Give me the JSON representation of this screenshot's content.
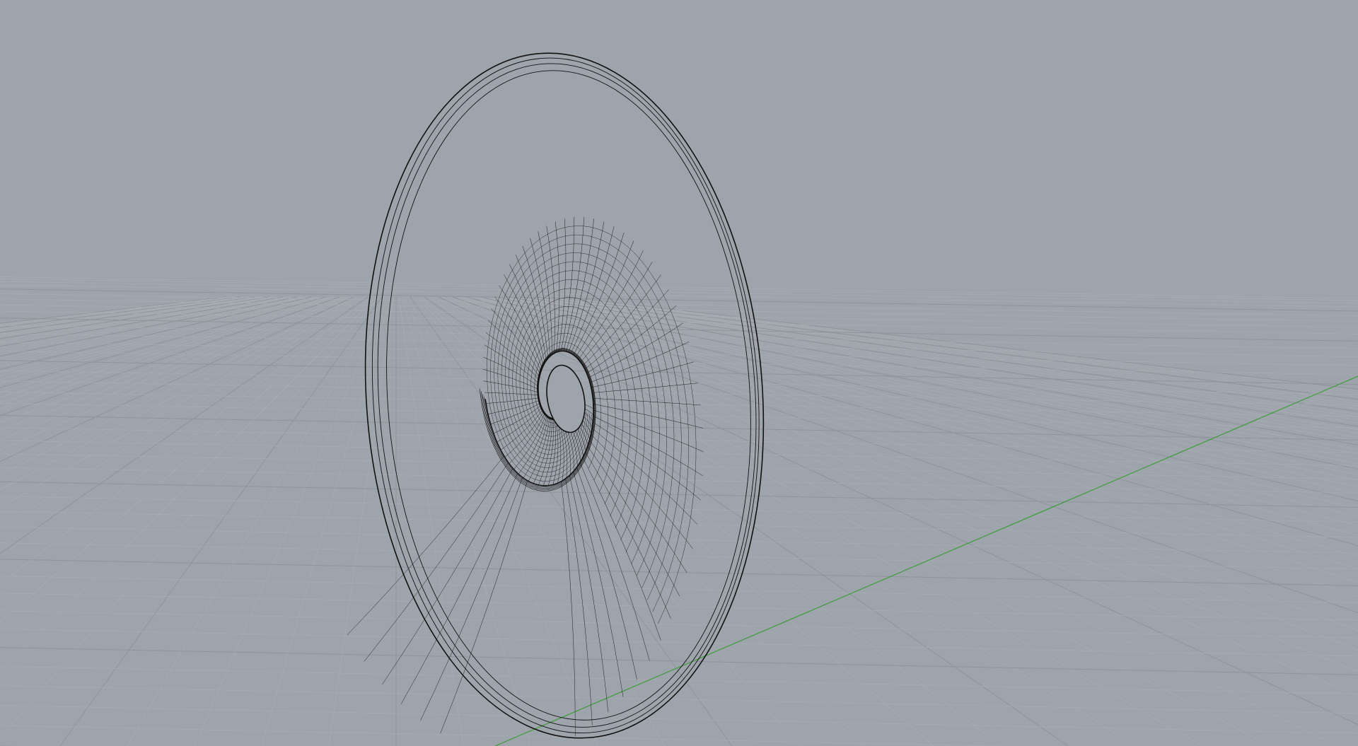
{
  "viewport": {
    "background_color": "#9ea4ab",
    "grid_minor_color": "#a8adb3",
    "grid_major_color": "#8e949a",
    "y_axis_color": "#3f9b3a",
    "wire_color": "#111111"
  },
  "model": {
    "kind": "spiral-shell",
    "display_mode": "wireframe"
  }
}
